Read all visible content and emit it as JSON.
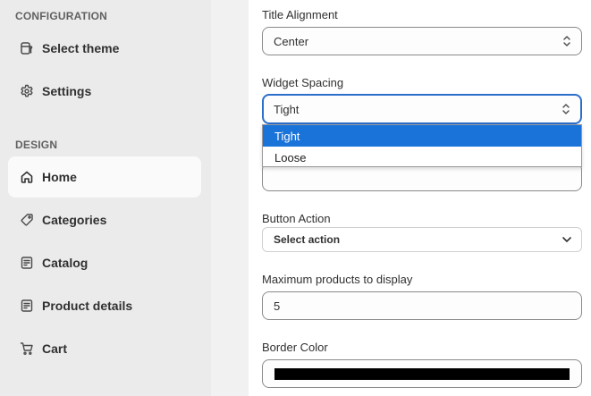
{
  "sidebar": {
    "configuration_heading": "CONFIGURATION",
    "design_heading": "DESIGN",
    "config_items": [
      {
        "label": "Select theme",
        "icon": "theme-icon"
      },
      {
        "label": "Settings",
        "icon": "gear-icon"
      }
    ],
    "design_items": [
      {
        "label": "Home",
        "icon": "home-icon",
        "active": true
      },
      {
        "label": "Categories",
        "icon": "tag-icon"
      },
      {
        "label": "Catalog",
        "icon": "catalog-icon"
      },
      {
        "label": "Product details",
        "icon": "product-details-icon"
      },
      {
        "label": "Cart",
        "icon": "cart-icon"
      }
    ]
  },
  "form": {
    "title_alignment": {
      "label": "Title Alignment",
      "value": "Center"
    },
    "widget_spacing": {
      "label": "Widget Spacing",
      "value": "Tight",
      "options": [
        "Tight",
        "Loose"
      ]
    },
    "button_action": {
      "label": "Button Action",
      "value": "Select action"
    },
    "max_products": {
      "label": "Maximum products to display",
      "value": "5"
    },
    "border_color": {
      "label": "Border Color",
      "value": "#000000"
    }
  },
  "colors": {
    "accent": "#2c6ecb",
    "selected_option": "#1a73d9",
    "sidebar_bg": "#ebebeb"
  }
}
